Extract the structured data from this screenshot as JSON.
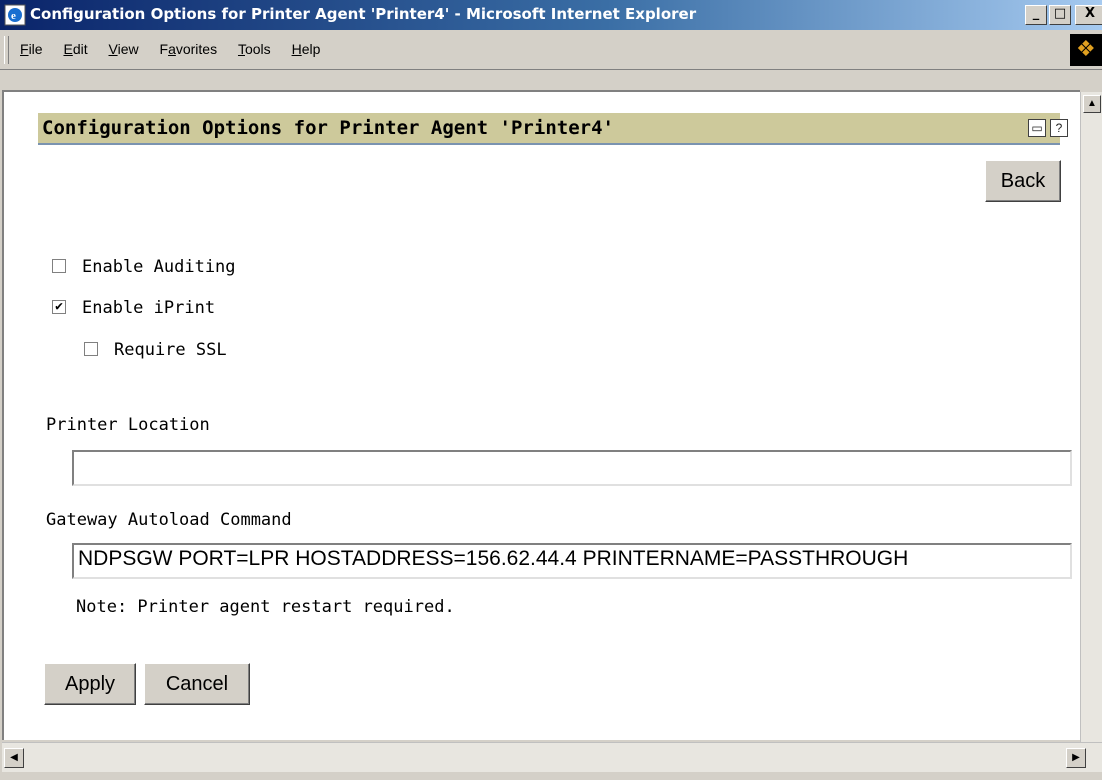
{
  "window": {
    "title": "Configuration Options for Printer Agent 'Printer4' - Microsoft Internet Explorer",
    "minimize_label": "_",
    "maximize_label": "□",
    "close_label": "X"
  },
  "menu": {
    "items": [
      {
        "accel": "F",
        "rest": "ile"
      },
      {
        "accel": "E",
        "rest": "dit"
      },
      {
        "accel": "V",
        "rest": "iew"
      },
      {
        "pre": "F",
        "accel": "a",
        "rest": "vorites"
      },
      {
        "accel": "T",
        "rest": "ools"
      },
      {
        "accel": "H",
        "rest": "elp"
      }
    ]
  },
  "page": {
    "title": "Configuration Options for Printer Agent 'Printer4'",
    "back_label": "Back",
    "options": {
      "enable_auditing": {
        "label": "Enable Auditing",
        "checked": false
      },
      "enable_iprint": {
        "label": "Enable iPrint",
        "checked": true
      },
      "require_ssl": {
        "label": "Require SSL",
        "checked": false
      }
    },
    "printer_location": {
      "label": "Printer Location",
      "value": ""
    },
    "gateway_autoload": {
      "label": "Gateway Autoload Command",
      "value": "NDPSGW PORT=LPR HOSTADDRESS=156.62.44.4   PRINTERNAME=PASSTHROUGH"
    },
    "note": "Note: Printer agent restart required.",
    "apply_label": "Apply",
    "cancel_label": "Cancel"
  },
  "icons": {
    "title_icon": "ie-page-icon",
    "print_icon": "printer-icon",
    "help_icon": "help-icon"
  },
  "colors": {
    "titlebar": "#0a246a",
    "header_bg": "#cdc99b",
    "chrome": "#d4d0c8"
  }
}
